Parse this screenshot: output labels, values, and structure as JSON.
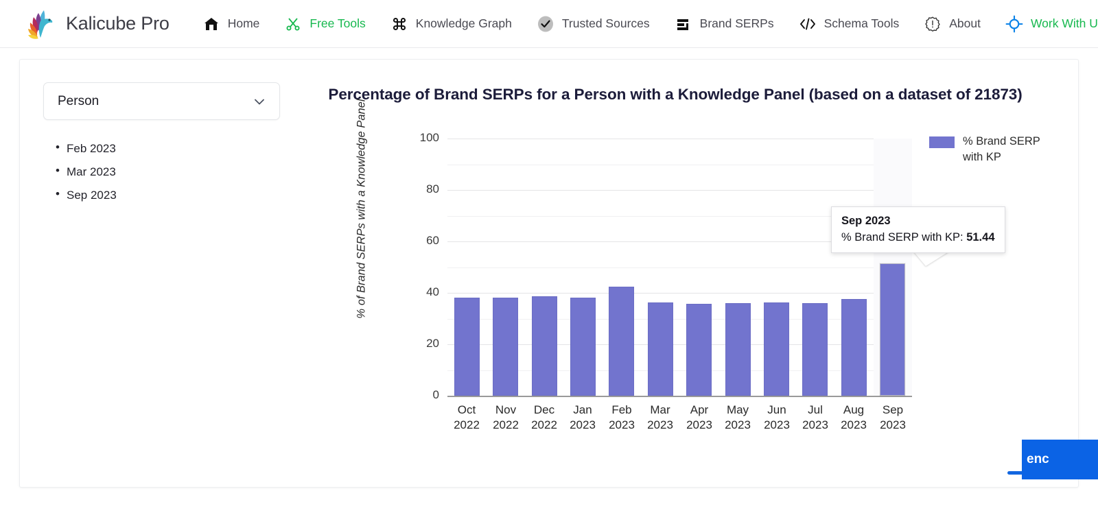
{
  "nav": {
    "brand": "Kalicube Pro",
    "items": [
      {
        "label": "Home",
        "icon": "home-icon",
        "color": "default"
      },
      {
        "label": "Free Tools",
        "icon": "scissors-icon",
        "color": "green"
      },
      {
        "label": "Knowledge Graph",
        "icon": "command-icon",
        "color": "default"
      },
      {
        "label": "Trusted Sources",
        "icon": "check-circle-icon",
        "color": "default"
      },
      {
        "label": "Brand SERPs",
        "icon": "bars-list-icon",
        "color": "default"
      },
      {
        "label": "Schema Tools",
        "icon": "code-brackets-icon",
        "color": "default"
      },
      {
        "label": "About",
        "icon": "info-badge-icon",
        "color": "default"
      },
      {
        "label": "Work With Us",
        "icon": "target-circle-icon",
        "color": "green"
      }
    ]
  },
  "sidebar": {
    "entity_select": {
      "value": "Person",
      "icon": "chevron-down-icon"
    },
    "updates": [
      "Feb 2023",
      "Mar 2023",
      "Sep 2023"
    ]
  },
  "tooltip": {
    "title": "Sep 2023",
    "label": "% Brand SERP with KP:",
    "value": "51.44"
  },
  "fab": {
    "label": "enc"
  },
  "chart_data": {
    "type": "bar",
    "title": "Percentage of Brand SERPs for a Person with a Knowledge Panel (based on a dataset of 21873)",
    "xlabel": "",
    "ylabel": "% of Brand SERPs with a Knowledge Panel",
    "ylim": [
      0,
      100
    ],
    "yticks": [
      0,
      20,
      40,
      60,
      80,
      100
    ],
    "grid": true,
    "legend_position": "right",
    "series": [
      {
        "name": "% Brand SERP with KP",
        "color": "#7274ce",
        "values": [
          38.1,
          38.2,
          38.6,
          38.2,
          42.4,
          36.3,
          35.7,
          36.0,
          36.2,
          36.1,
          37.7,
          51.44
        ]
      }
    ],
    "categories": [
      "Oct\n2022",
      "Nov\n2022",
      "Dec\n2022",
      "Jan\n2023",
      "Feb\n2023",
      "Mar\n2023",
      "Apr\n2023",
      "May\n2023",
      "Jun\n2023",
      "Jul\n2023",
      "Aug\n2023",
      "Sep\n2023"
    ],
    "categories_month": [
      "Oct",
      "Nov",
      "Dec",
      "Jan",
      "Feb",
      "Mar",
      "Apr",
      "May",
      "Jun",
      "Jul",
      "Aug",
      "Sep"
    ],
    "categories_year": [
      "2022",
      "2022",
      "2022",
      "2023",
      "2023",
      "2023",
      "2023",
      "2023",
      "2023",
      "2023",
      "2023",
      "2023"
    ],
    "highlighted_index": 11
  }
}
